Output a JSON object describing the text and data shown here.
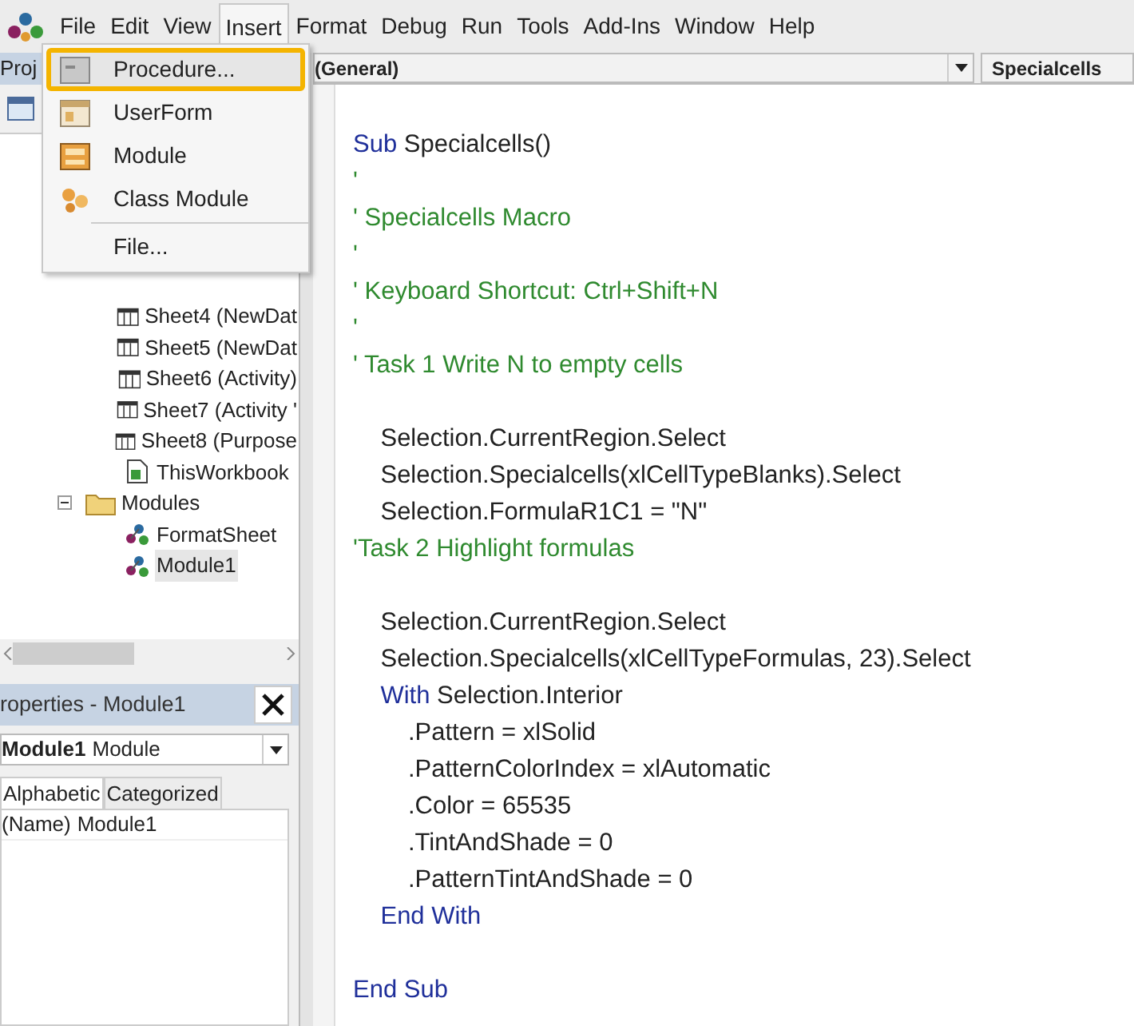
{
  "menu_bar": [
    {
      "label": "File",
      "selected": false
    },
    {
      "label": "Edit",
      "selected": false
    },
    {
      "label": "View",
      "selected": false
    },
    {
      "label": "Insert",
      "selected": true
    },
    {
      "label": "Format",
      "selected": false
    },
    {
      "label": "Debug",
      "selected": false
    },
    {
      "label": "Run",
      "selected": false
    },
    {
      "label": "Tools",
      "selected": false
    },
    {
      "label": "Add-Ins",
      "selected": false
    },
    {
      "label": "Window",
      "selected": false
    },
    {
      "label": "Help",
      "selected": false
    }
  ],
  "insert_menu": [
    {
      "label": "Procedure...",
      "kind": "procedure",
      "highlighted": true
    },
    {
      "label": "UserForm",
      "kind": "userform",
      "highlighted": false
    },
    {
      "label": "Module",
      "kind": "module",
      "highlighted": false
    },
    {
      "label": "Class Module",
      "kind": "class",
      "highlighted": false
    },
    {
      "label": "File...",
      "kind": "file",
      "highlighted": false
    }
  ],
  "project_panel": {
    "title": "Proj",
    "tree": [
      {
        "label": "Sheet4 (NewDat",
        "kind": "sheet",
        "selected": false
      },
      {
        "label": "Sheet5 (NewDat",
        "kind": "sheet",
        "selected": false
      },
      {
        "label": "Sheet6 (Activity)",
        "kind": "sheet",
        "selected": false
      },
      {
        "label": "Sheet7 (Activity '",
        "kind": "sheet",
        "selected": false
      },
      {
        "label": "Sheet8 (Purpose",
        "kind": "sheet",
        "selected": false
      },
      {
        "label": "ThisWorkbook",
        "kind": "workbook",
        "selected": false
      },
      {
        "label": "Modules",
        "kind": "folder",
        "expanded": true,
        "children": [
          {
            "label": "FormatSheet",
            "kind": "module",
            "selected": false
          },
          {
            "label": "Module1",
            "kind": "module",
            "selected": true
          }
        ]
      }
    ]
  },
  "properties_panel": {
    "title": "roperties - Module1",
    "object_name": "Module1",
    "object_type": "Module",
    "tabs": [
      {
        "label": "Alphabetic",
        "selected": true
      },
      {
        "label": "Categorized",
        "selected": false
      }
    ],
    "rows": [
      {
        "name": "(Name)",
        "value": "Module1"
      }
    ]
  },
  "code_window": {
    "object": "(General)",
    "procedure": "Specialcells",
    "blocks": [
      {
        "lines": [
          {
            "parts": [
              {
                "text": "Sub",
                "kind": "keyword"
              },
              {
                "text": " Specialcells()",
                "kind": "plain"
              }
            ]
          },
          {
            "parts": [
              {
                "text": "'",
                "kind": "comment"
              }
            ]
          },
          {
            "parts": [
              {
                "text": "' Specialcells Macro",
                "kind": "comment"
              }
            ]
          },
          {
            "parts": [
              {
                "text": "'",
                "kind": "comment"
              }
            ]
          },
          {
            "parts": [
              {
                "text": "' Keyboard Shortcut: Ctrl+Shift+N",
                "kind": "comment"
              }
            ]
          },
          {
            "parts": [
              {
                "text": "'",
                "kind": "comment"
              }
            ]
          },
          {
            "parts": [
              {
                "text": "' Task 1 Write N to empty cells",
                "kind": "comment"
              }
            ]
          }
        ]
      },
      {
        "lines": [
          {
            "parts": [
              {
                "text": "    Selection.CurrentRegion.Select",
                "kind": "plain"
              }
            ]
          },
          {
            "parts": [
              {
                "text": "    Selection.Specialcells(xlCellTypeBlanks).Select",
                "kind": "plain"
              }
            ]
          },
          {
            "parts": [
              {
                "text": "    Selection.FormulaR1C1 = \"N\"",
                "kind": "plain"
              }
            ]
          },
          {
            "parts": [
              {
                "text": "'Task 2 Highlight formulas",
                "kind": "comment"
              }
            ]
          }
        ]
      },
      {
        "lines": [
          {
            "parts": [
              {
                "text": "    Selection.CurrentRegion.Select",
                "kind": "plain"
              }
            ]
          },
          {
            "parts": [
              {
                "text": "    Selection.Specialcells(xlCellTypeFormulas, 23).Select",
                "kind": "plain"
              }
            ]
          },
          {
            "parts": [
              {
                "text": "    With",
                "kind": "keyword"
              },
              {
                "text": " Selection.Interior",
                "kind": "plain"
              }
            ]
          },
          {
            "parts": [
              {
                "text": "        .Pattern = xlSolid",
                "kind": "plain"
              }
            ]
          },
          {
            "parts": [
              {
                "text": "        .PatternColorIndex = xlAutomatic",
                "kind": "plain"
              }
            ]
          },
          {
            "parts": [
              {
                "text": "        .Color = 65535",
                "kind": "plain"
              }
            ]
          },
          {
            "parts": [
              {
                "text": "        .TintAndShade = 0",
                "kind": "plain"
              }
            ]
          },
          {
            "parts": [
              {
                "text": "        .PatternTintAndShade = 0",
                "kind": "plain"
              }
            ]
          },
          {
            "parts": [
              {
                "text": "    End With",
                "kind": "keyword"
              }
            ]
          }
        ]
      },
      {
        "lines": [
          {
            "parts": [
              {
                "text": "End Sub",
                "kind": "keyword"
              }
            ]
          }
        ]
      }
    ]
  }
}
